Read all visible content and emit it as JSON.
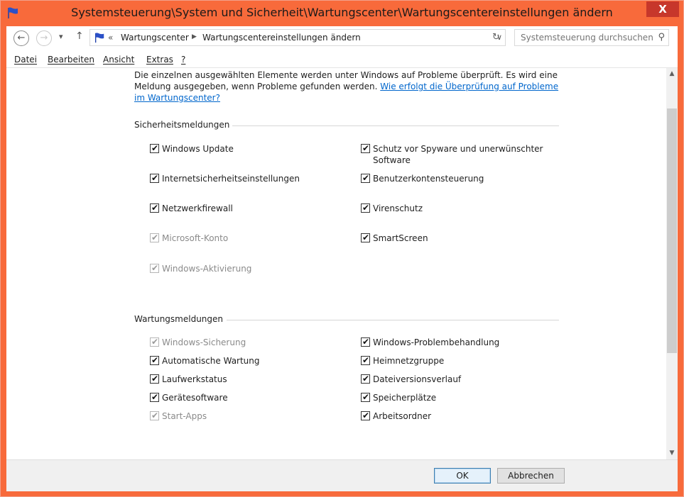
{
  "window": {
    "title": "Systemsteuerung\\System und Sicherheit\\Wartungscenter\\Wartungscentereinstellungen ändern",
    "close_glyph": "X"
  },
  "colors": {
    "frame": "#f86a3b",
    "close": "#c7372b",
    "link": "#0066cc",
    "accent_flag": "#1d3ea8"
  },
  "addressbar": {
    "back_glyph": "←",
    "forward_glyph": "→",
    "recent_glyph": "▾",
    "up_glyph": "↑",
    "overflow": "«",
    "crumbs": [
      "Wartungscenter",
      "Wartungscentereinstellungen ändern"
    ],
    "crumb_sep": "▶",
    "dropdown_glyph": "∨",
    "refresh_glyph": "↻",
    "search_placeholder": "Systemsteuerung durchsuchen",
    "search_glyph": "⚲"
  },
  "menu": [
    "Datei",
    "Bearbeiten",
    "Ansicht",
    "Extras",
    "?"
  ],
  "intro": {
    "text": "Die einzelnen ausgewählten Elemente werden unter Windows auf Probleme überprüft. Es wird eine Meldung ausgegeben, wenn Probleme gefunden werden. ",
    "link": "Wie erfolgt die Überprüfung auf Probleme im Wartungscenter?"
  },
  "security": {
    "title": "Sicherheitsmeldungen",
    "left": [
      {
        "label": "Windows Update",
        "checked": true,
        "disabled": false
      },
      {
        "label": "Internetsicherheitseinstellungen",
        "checked": true,
        "disabled": false
      },
      {
        "label": "Netzwerkfirewall",
        "checked": true,
        "disabled": false
      },
      {
        "label": "Microsoft-Konto",
        "checked": true,
        "disabled": true
      },
      {
        "label": "Windows-Aktivierung",
        "checked": true,
        "disabled": true
      }
    ],
    "right": [
      {
        "label": "Schutz vor Spyware und unerwünschter",
        "label2": "Software",
        "checked": true,
        "disabled": false
      },
      {
        "label": "Benutzerkontensteuerung",
        "checked": true,
        "disabled": false
      },
      {
        "label": "Virenschutz",
        "checked": true,
        "disabled": false
      },
      {
        "label": "SmartScreen",
        "checked": true,
        "disabled": false
      }
    ]
  },
  "maintenance": {
    "title": "Wartungsmeldungen",
    "left": [
      {
        "label": "Windows-Sicherung",
        "checked": true,
        "disabled": true
      },
      {
        "label": "Automatische Wartung",
        "checked": true,
        "disabled": false
      },
      {
        "label": "Laufwerkstatus",
        "checked": true,
        "disabled": false
      },
      {
        "label": "Gerätesoftware",
        "checked": true,
        "disabled": false
      },
      {
        "label": "Start-Apps",
        "checked": true,
        "disabled": true
      }
    ],
    "right": [
      {
        "label": "Windows-Problembehandlung",
        "checked": true,
        "disabled": false
      },
      {
        "label": "Heimnetzgruppe",
        "checked": true,
        "disabled": false
      },
      {
        "label": "Dateiversionsverlauf",
        "checked": true,
        "disabled": false
      },
      {
        "label": "Speicherplätze",
        "checked": true,
        "disabled": false
      },
      {
        "label": "Arbeitsordner",
        "checked": true,
        "disabled": false
      }
    ]
  },
  "checkmark": "✔",
  "scroll": {
    "up": "▲",
    "down": "▼"
  },
  "buttons": {
    "ok": "OK",
    "cancel": "Abbrechen"
  }
}
